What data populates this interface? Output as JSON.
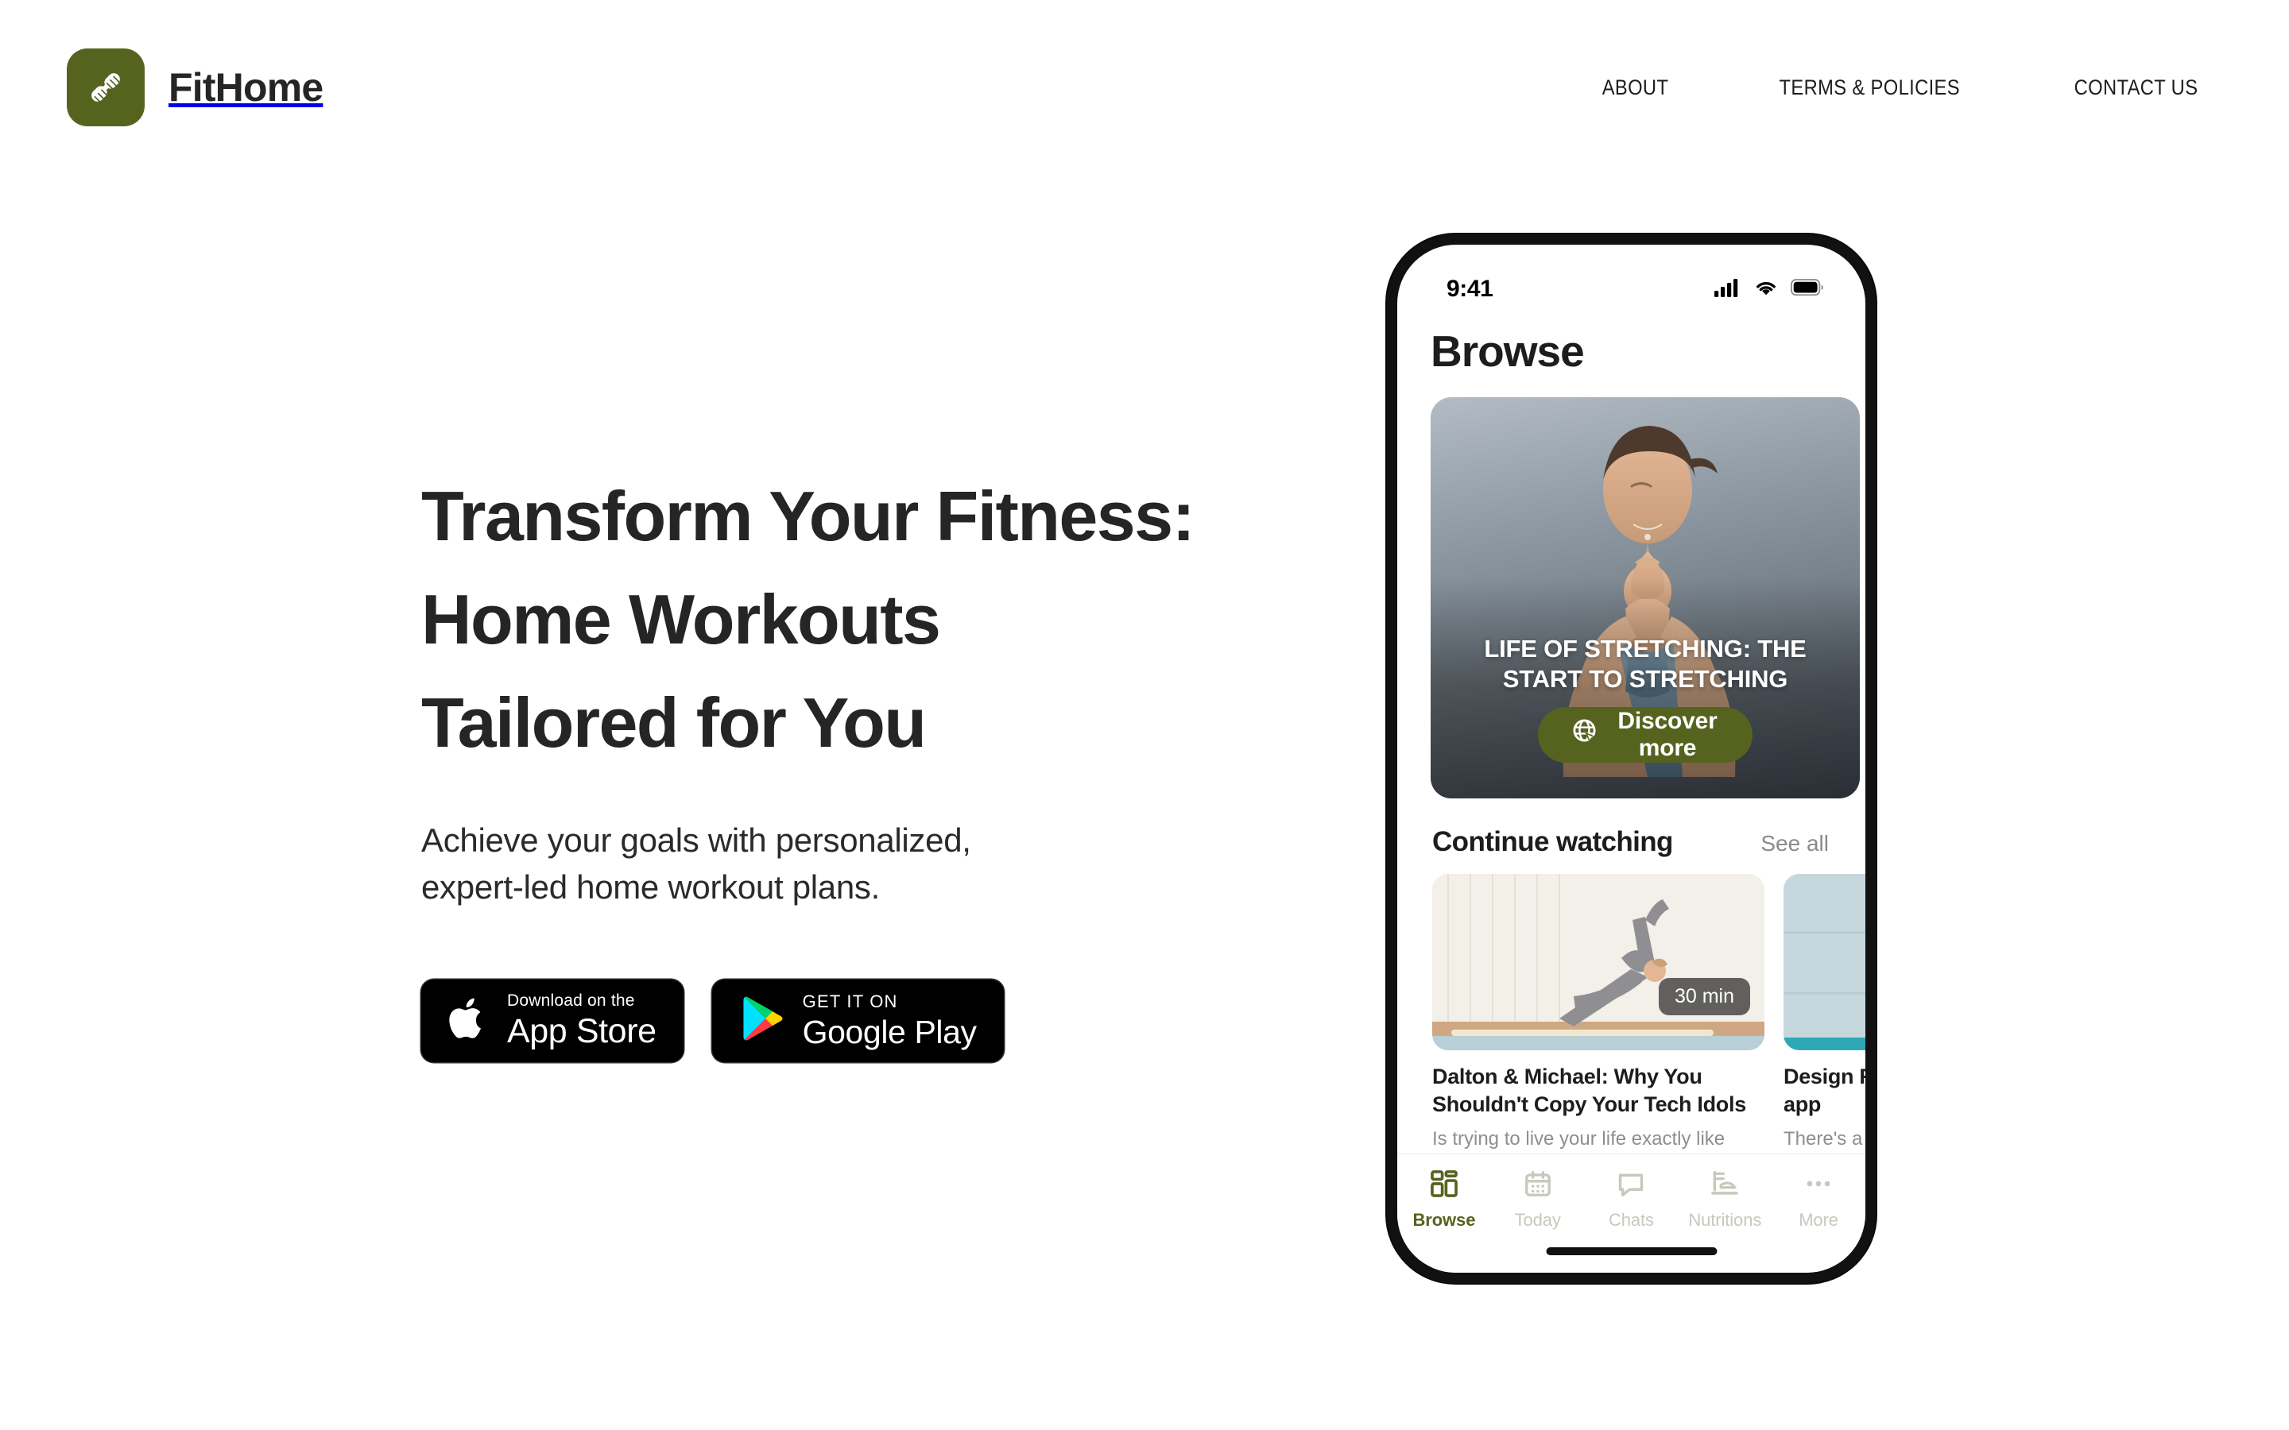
{
  "header": {
    "brand_name": "FitHome",
    "brand_icon": "dumbbell-icon",
    "brand_color": "#55631F",
    "nav": [
      {
        "label": "ABOUT"
      },
      {
        "label": "TERMS & POLICIES"
      },
      {
        "label": "CONTACT US"
      }
    ]
  },
  "hero": {
    "title_line_1": "Transform Your Fitness:",
    "title_line_2": "Home Workouts",
    "title_line_3": "Tailored for You",
    "subtitle_line_1": "Achieve your goals with personalized,",
    "subtitle_line_2": "expert-led home workout plans.",
    "badges": [
      {
        "icon": "apple-icon",
        "small": "Download on the",
        "big": "App Store"
      },
      {
        "icon": "google-play-icon",
        "small": "GET IT ON",
        "big": "Google Play"
      }
    ]
  },
  "phone": {
    "status_bar": {
      "time": "9:41",
      "icons": [
        "cellular-signal-icon",
        "wifi-icon",
        "battery-icon"
      ]
    },
    "screen_title": "Browse",
    "hero_card": {
      "title": "LIFE OF STRETCHING: THE START TO STRETCHING",
      "button_label": "Discover more",
      "button_icon": "globe-click-icon",
      "button_color": "#55631F"
    },
    "continue_watching": {
      "section_title": "Continue watching",
      "see_all_label": "See all",
      "cards": [
        {
          "title": "Dalton & Michael: Why You Shouldn't Copy Your Tech Idols",
          "description": "Is trying to live your life exactly like Elon Musk, Steve Jobs, or Mark Zuckerberg a good stra...",
          "duration_badge": "30 min"
        },
        {
          "title": "Design Review mobile app",
          "description": "There's a lot to th mobile apps, whe"
        }
      ]
    },
    "tab_bar": [
      {
        "label": "Browse",
        "icon": "grid-icon",
        "active": true
      },
      {
        "label": "Today",
        "icon": "calendar-icon",
        "active": false
      },
      {
        "label": "Chats",
        "icon": "chat-icon",
        "active": false
      },
      {
        "label": "Nutritions",
        "icon": "food-icon",
        "active": false
      },
      {
        "label": "More",
        "icon": "ellipsis-icon",
        "active": false
      }
    ]
  }
}
